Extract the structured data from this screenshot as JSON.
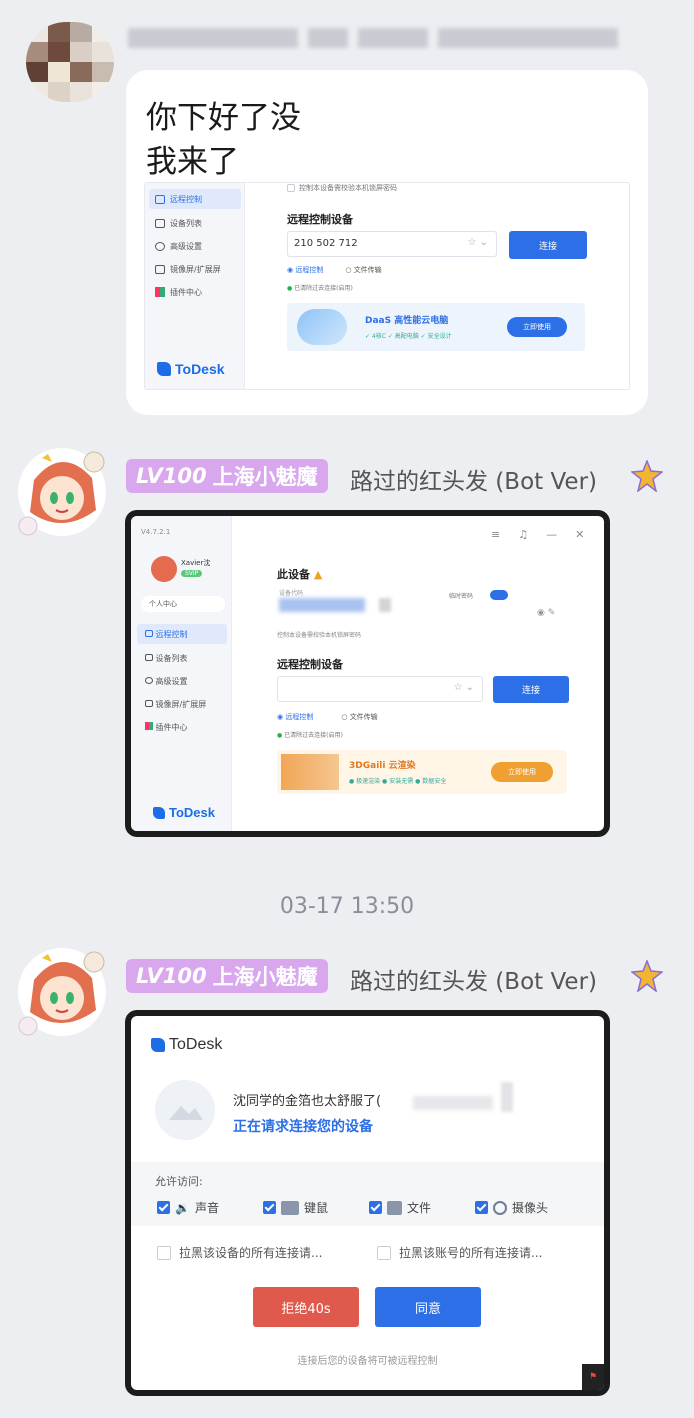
{
  "message1": {
    "text_line1": "你下好了没",
    "text_line2": "我来了",
    "screenshot": {
      "sidebar": [
        "远程控制",
        "设备列表",
        "高级设置",
        "镜像屏/扩展屏",
        "插件中心"
      ],
      "logo": "ToDesk",
      "top_option": "控制本设备需校验本机锁屏密码",
      "section_title": "远程控制设备",
      "device_code_value": "210 502 712",
      "connect_label": "连接",
      "mode_remote": "远程控制",
      "mode_file": "文件传输",
      "status_text": "已清除过去连接(启用)",
      "ad_title": "DaaS 高性能云电脑",
      "ad_features": "✓ 4核C  ✓ 高配电脑  ✓ 安全设计",
      "ad_button": "立即使用"
    }
  },
  "message2": {
    "badge_level": "LV100",
    "badge_title": "上海小魅魔",
    "nickname": "路过的红头发 (Bot Ver)",
    "screenshot": {
      "version": "V4.7.2.1",
      "username": "Xavier沈",
      "user_tag": "SVIP",
      "personal_center": "个人中心",
      "sidebar": [
        "远程控制",
        "设备列表",
        "高级设置",
        "镜像屏/扩展屏",
        "插件中心"
      ],
      "logo": "ToDesk",
      "this_device": "此设备",
      "device_code_label": "设备代码",
      "temp_password_label": "临时密码",
      "top_option": "控制本设备需校验本机锁屏密码",
      "section_title": "远程控制设备",
      "connect_label": "连接",
      "mode_remote": "远程控制",
      "mode_file": "文件传输",
      "status_text": "已清除过去连接(启用)",
      "ad_title": "3DGaili 云渲染",
      "ad_features": "● 极速渲染  ● 安装无需  ● 数据安全",
      "ad_button": "立即使用"
    }
  },
  "timestamp": "03-17 13:50",
  "message3": {
    "badge_level": "LV100",
    "badge_title": "上海小魅魔",
    "nickname": "路过的红头发 (Bot Ver)",
    "dialog": {
      "logo": "ToDesk",
      "requester": "沈同学的金箔也太舒服了(",
      "request_text": "正在请求连接您的设备",
      "allow_label": "允许访问:",
      "permissions": [
        "声音",
        "键鼠",
        "文件",
        "摄像头"
      ],
      "block_device": "拉黑该设备的所有连接请...",
      "block_account": "拉黑该账号的所有连接请...",
      "reject_label": "拒绝40s",
      "accept_label": "同意",
      "footer": "连接后您的设备将可被远程控制"
    }
  },
  "colors": {
    "page_bg": "#edeef2",
    "todesk_blue": "#2c6fe6",
    "reject_red": "#e0594d",
    "badge_purple": "#d8a7ee"
  }
}
